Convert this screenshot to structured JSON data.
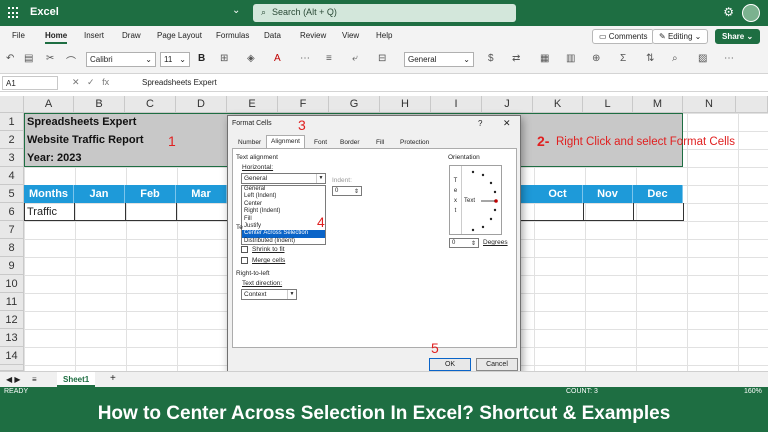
{
  "titlebar": {
    "app": "Excel",
    "search_placeholder": "Search (Alt + Q)"
  },
  "menu": {
    "items": [
      "File",
      "Home",
      "Insert",
      "Draw",
      "Page Layout",
      "Formulas",
      "Data",
      "Review",
      "View",
      "Help"
    ],
    "active": "Home",
    "comments": "Comments",
    "editing": "Editing",
    "share": "Share"
  },
  "ribbon": {
    "font": "Calibri",
    "size": "11",
    "format": "General",
    "bold": "B"
  },
  "formula_bar": {
    "name_box": "A1",
    "content": "Spreadsheets Expert"
  },
  "columns": [
    "A",
    "B",
    "C",
    "D",
    "E",
    "F",
    "G",
    "H",
    "I",
    "J",
    "K",
    "L",
    "M",
    "N"
  ],
  "rows": [
    "1",
    "2",
    "3",
    "4",
    "5",
    "6",
    "7",
    "8",
    "9",
    "10",
    "11",
    "12",
    "13",
    "14"
  ],
  "cells": {
    "a1": "Spreadsheets Expert",
    "a2": "Website Traffic Report",
    "a3": "Year: 2023",
    "a6": "Traffic"
  },
  "months_header": [
    "Months",
    "Jan",
    "Feb",
    "Mar",
    "Oct",
    "Nov",
    "Dec"
  ],
  "annotations": {
    "step1": "1",
    "step2": "2-",
    "step2_text": "Right Click and select Format Cells",
    "step3": "3",
    "step4": "4",
    "step5": "5"
  },
  "dialog": {
    "title": "Format Cells",
    "help": "?",
    "close": "✕",
    "tabs": [
      "Number",
      "Alignment",
      "Font",
      "Border",
      "Fill",
      "Protection"
    ],
    "active_tab": "Alignment",
    "text_alignment": "Text alignment",
    "horizontal_label": "Horizontal:",
    "horizontal_value": "General",
    "indent_label": "Indent:",
    "indent_value": "0",
    "horizontal_options": [
      "General",
      "Left (Indent)",
      "Center",
      "Right (Indent)",
      "Fill",
      "Justify",
      "Center Across Selection",
      "Distributed (Indent)"
    ],
    "highlighted_option": "Center Across Selection",
    "text_control_label": "Te",
    "shrink_label": "Shrink to fit",
    "merge_label": "Merge cells",
    "rtl_label": "Right-to-left",
    "text_direction_label": "Text direction:",
    "text_direction_value": "Context",
    "orientation_label": "Orientation",
    "orientation_text": "Text",
    "vertical_text": [
      "T",
      "e",
      "x",
      "t"
    ],
    "degrees_value": "0",
    "degrees_label": "Degrees",
    "ok": "OK",
    "cancel": "Cancel"
  },
  "sheets": {
    "tab": "Sheet1",
    "add": "+"
  },
  "status": {
    "left": "READY",
    "count": "COUNT: 3",
    "zoom": "160%"
  },
  "banner": "How to Center Across Selection In Excel? Shortcut & Examples",
  "colors": {
    "excel_green": "#1e6e42",
    "header_blue": "#1e9ad9",
    "annotation_red": "#e02020",
    "selection_blue": "#0a64c8"
  }
}
